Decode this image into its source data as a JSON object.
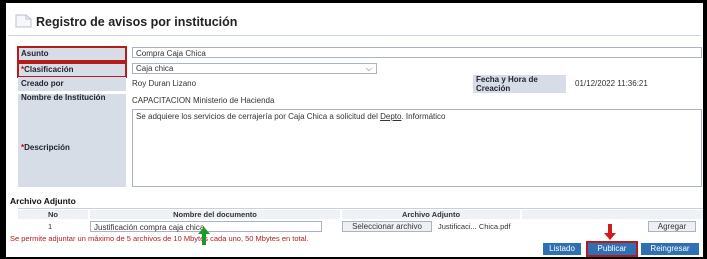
{
  "page": {
    "title": "Registro de avisos por institución"
  },
  "form": {
    "asunto": {
      "label": "Asunto",
      "value": "Compra Caja Chica"
    },
    "clasificacion": {
      "label": "Clasificación",
      "value": "Caja chica"
    },
    "creado_por": {
      "label": "Creado por",
      "value": "Roy Duran Lizano"
    },
    "fecha": {
      "label": "Fecha y Hora de Creación",
      "value": "01/12/2022 11:36:21"
    },
    "institucion": {
      "label": "Nombre de Institución",
      "value": "CAPACITACION Ministerio de Hacienda"
    },
    "descripcion": {
      "label": "Descripción",
      "text_before": "Se adquiere los servicios de cerrajería  por Caja Chica a solicitud del ",
      "link": "Depto",
      "text_after": ". Informático"
    }
  },
  "adjunto": {
    "section_title": "Archivo Adjunto",
    "headers": [
      "No",
      "Nombre del documento",
      "Archivo Adjunto"
    ],
    "row": {
      "no": "1",
      "nombre": "Justificación compra caja chica",
      "select_button": "Seleccionar archivo",
      "file": "Justificaci... Chica.pdf",
      "add_button": "Agregar"
    },
    "note": "Se permite adjuntar un máximo de 5 archivos de 10 Mbytes cada uno, 50 Mbytes en total."
  },
  "actions": {
    "listado": "Listado",
    "publicar": "Publicar",
    "reingresar": "Reingresar"
  },
  "colors": {
    "accent": "#2f6fb3",
    "highlight": "#b51b1b",
    "arrow_red": "#d11a1a",
    "arrow_green": "#1a9a2a"
  }
}
